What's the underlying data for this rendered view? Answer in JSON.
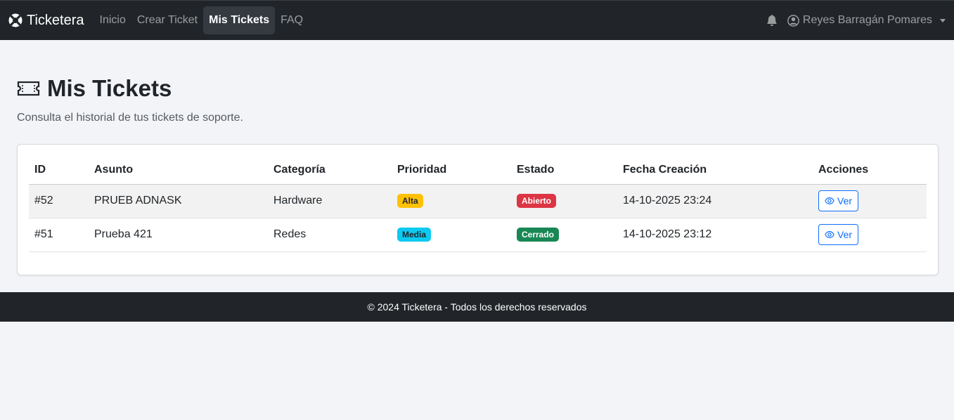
{
  "navbar": {
    "brand": "Ticketera",
    "links": [
      {
        "label": "Inicio"
      },
      {
        "label": "Crear Ticket"
      },
      {
        "label": "Mis Tickets"
      },
      {
        "label": "FAQ"
      }
    ],
    "user_name": "Reyes Barragán Pomares",
    "icons": {
      "brand": "life-ring-icon",
      "notifications": "bell-icon",
      "user": "user-circle-icon"
    }
  },
  "page": {
    "title": "Mis Tickets",
    "subtitle": "Consulta el historial de tus tickets de soporte.",
    "title_icon": "ticket-icon"
  },
  "table": {
    "headers": [
      "ID",
      "Asunto",
      "Categoría",
      "Prioridad",
      "Estado",
      "Fecha Creación",
      "Acciones"
    ],
    "rows": [
      {
        "id": "#52",
        "asunto": "PRUEB ADNASK",
        "categoria": "Hardware",
        "prioridad": "Alta",
        "estado": "Abierto",
        "fecha": "14-10-2025 23:24",
        "accion": "Ver"
      },
      {
        "id": "#51",
        "asunto": "Prueba 421",
        "categoria": "Redes",
        "prioridad": "Media",
        "estado": "Cerrado",
        "fecha": "14-10-2025 23:12",
        "accion": "Ver"
      }
    ]
  },
  "colors": {
    "alta": "#ffc107",
    "media": "#0dcaf0",
    "abierto": "#dc3545",
    "cerrado": "#198754",
    "primary": "#0d6efd",
    "navbar": "#212529"
  },
  "footer": {
    "text": "© 2024 Ticketera - Todos los derechos reservados"
  }
}
